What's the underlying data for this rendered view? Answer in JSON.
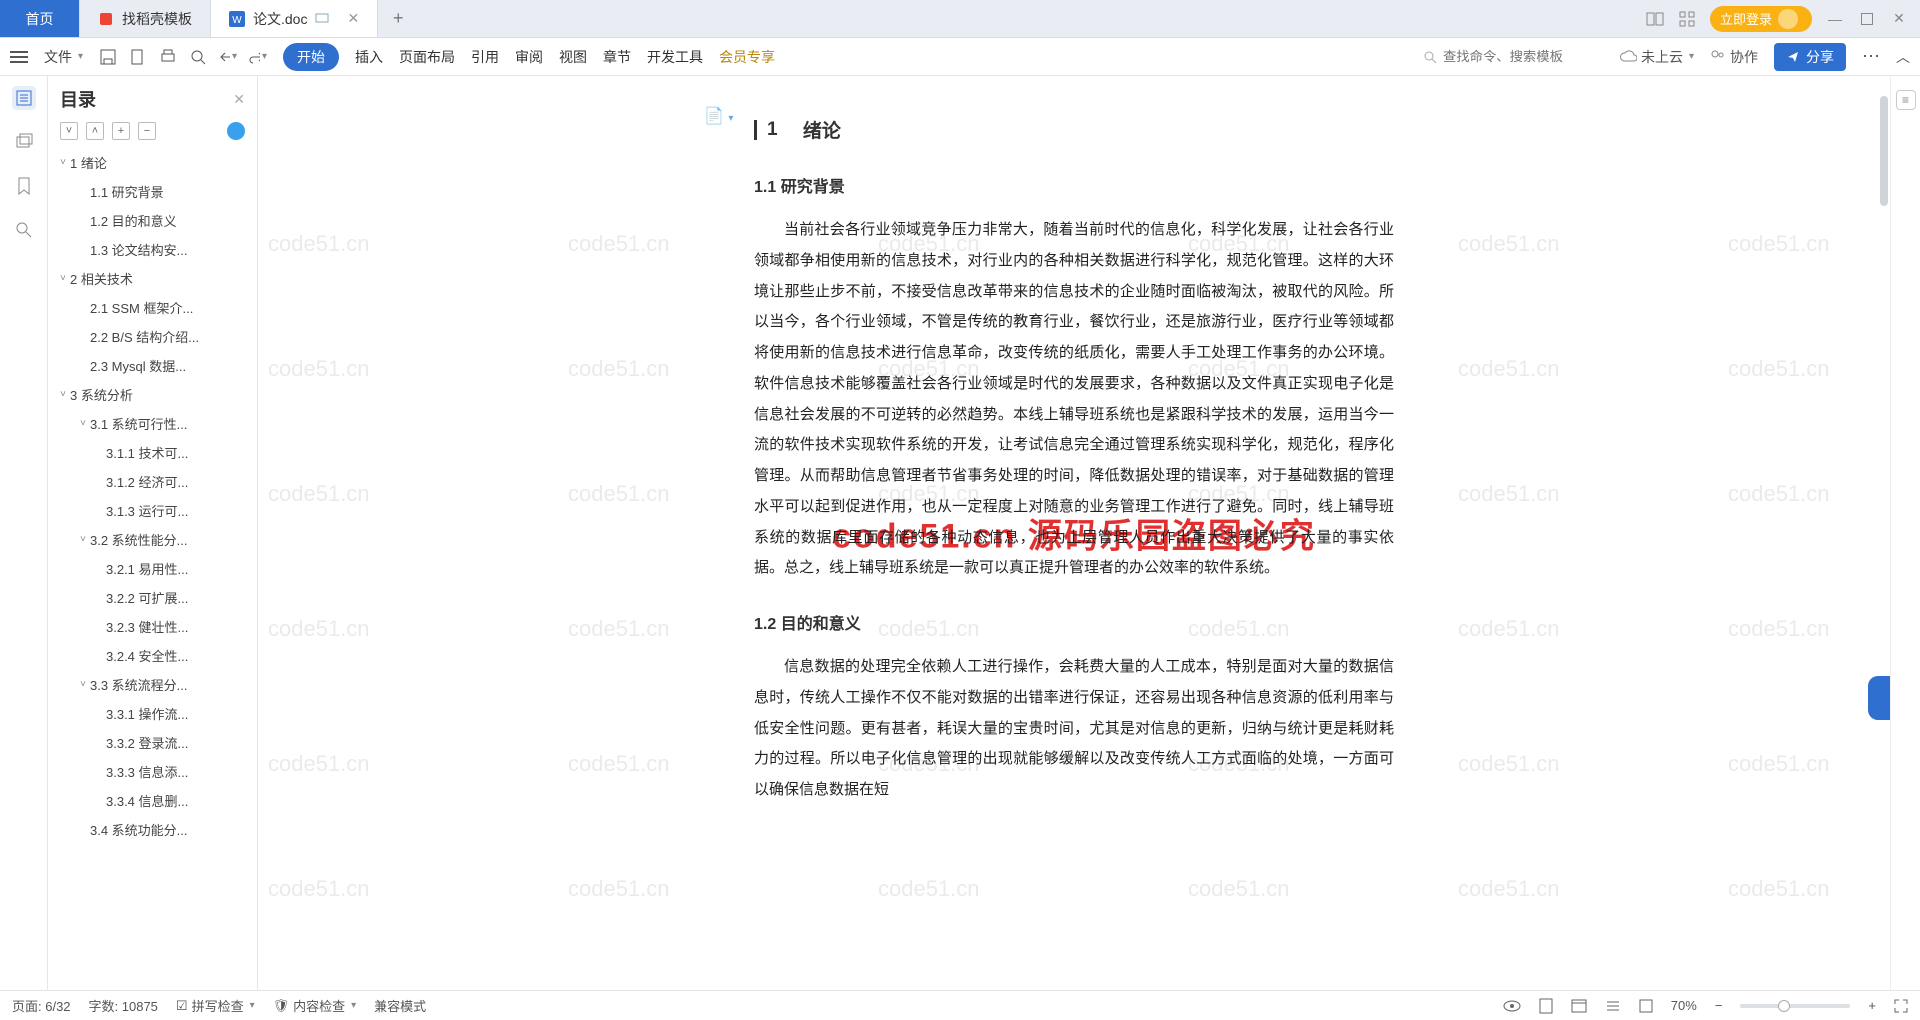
{
  "tabs": {
    "home": "首页",
    "t1": "找稻壳模板",
    "t2": "论文.doc",
    "add": "+"
  },
  "window": {
    "login": "立即登录"
  },
  "toolbar": {
    "file": "文件",
    "start": "开始",
    "menus": [
      "插入",
      "页面布局",
      "引用",
      "审阅",
      "视图",
      "章节",
      "开发工具"
    ],
    "member": "会员专享",
    "search_ph": "查找命令、搜索模板",
    "cloud": "未上云",
    "collab": "协作",
    "share": "分享"
  },
  "outline": {
    "title": "目录",
    "items": [
      {
        "lvl": 1,
        "chev": "˅",
        "t": "1  绪论"
      },
      {
        "lvl": 2,
        "t": "1.1  研究背景"
      },
      {
        "lvl": 2,
        "t": "1.2  目的和意义"
      },
      {
        "lvl": 2,
        "t": "1.3  论文结构安..."
      },
      {
        "lvl": 1,
        "chev": "˅",
        "t": "2  相关技术"
      },
      {
        "lvl": 2,
        "t": "2.1  SSM 框架介..."
      },
      {
        "lvl": 2,
        "t": "2.2  B/S 结构介绍..."
      },
      {
        "lvl": 2,
        "t": "2.3  Mysql 数据..."
      },
      {
        "lvl": 1,
        "chev": "˅",
        "t": "3  系统分析"
      },
      {
        "lvl": 2,
        "chev": "˅",
        "t": "3.1  系统可行性..."
      },
      {
        "lvl": 3,
        "t": "3.1.1  技术可..."
      },
      {
        "lvl": 3,
        "t": "3.1.2  经济可..."
      },
      {
        "lvl": 3,
        "t": "3.1.3  运行可..."
      },
      {
        "lvl": 2,
        "chev": "˅",
        "t": "3.2  系统性能分..."
      },
      {
        "lvl": 3,
        "t": "3.2.1  易用性..."
      },
      {
        "lvl": 3,
        "t": "3.2.2  可扩展..."
      },
      {
        "lvl": 3,
        "t": "3.2.3  健壮性..."
      },
      {
        "lvl": 3,
        "t": "3.2.4  安全性..."
      },
      {
        "lvl": 2,
        "chev": "˅",
        "t": "3.3  系统流程分..."
      },
      {
        "lvl": 3,
        "t": "3.3.1  操作流..."
      },
      {
        "lvl": 3,
        "t": "3.3.2  登录流..."
      },
      {
        "lvl": 3,
        "t": "3.3.3  信息添..."
      },
      {
        "lvl": 3,
        "t": "3.3.4  信息删..."
      },
      {
        "lvl": 2,
        "t": "3.4  系统功能分..."
      }
    ]
  },
  "doc": {
    "h1_num": "1",
    "h1": "绪论",
    "h11": "1.1  研究背景",
    "p1": "当前社会各行业领域竞争压力非常大，随着当前时代的信息化，科学化发展，让社会各行业领域都争相使用新的信息技术，对行业内的各种相关数据进行科学化，规范化管理。这样的大环境让那些止步不前，不接受信息改革带来的信息技术的企业随时面临被淘汰，被取代的风险。所以当今，各个行业领域，不管是传统的教育行业，餐饮行业，还是旅游行业，医疗行业等领域都将使用新的信息技术进行信息革命，改变传统的纸质化，需要人手工处理工作事务的办公环境。软件信息技术能够覆盖社会各行业领域是时代的发展要求，各种数据以及文件真正实现电子化是信息社会发展的不可逆转的必然趋势。本线上辅导班系统也是紧跟科学技术的发展，运用当今一流的软件技术实现软件系统的开发，让考试信息完全通过管理系统实现科学化，规范化，程序化管理。从而帮助信息管理者节省事务处理的时间，降低数据处理的错误率，对于基础数据的管理水平可以起到促进作用，也从一定程度上对随意的业务管理工作进行了避免。同时，线上辅导班系统的数据库里面存储的各种动态信息，也为上层管理人员作出重大决策提供了大量的事实依据。总之，线上辅导班系统是一款可以真正提升管理者的办公效率的软件系统。",
    "h12": "1.2  目的和意义",
    "p2": "信息数据的处理完全依赖人工进行操作，会耗费大量的人工成本，特别是面对大量的数据信息时，传统人工操作不仅不能对数据的出错率进行保证，还容易出现各种信息资源的低利用率与低安全性问题。更有甚者，耗误大量的宝贵时间，尤其是对信息的更新，归纳与统计更是耗财耗力的过程。所以电子化信息管理的出现就能够缓解以及改变传统人工方式面临的处境，一方面可以确保信息数据在短"
  },
  "wm": "code51.cn",
  "wm_red": "code51.cn   源码乐园盗图必究",
  "status": {
    "page": "页面: 6/32",
    "words": "字数: 10875",
    "spell": "拼写检查",
    "content": "内容检查",
    "compat": "兼容模式",
    "zoom": "70%"
  }
}
